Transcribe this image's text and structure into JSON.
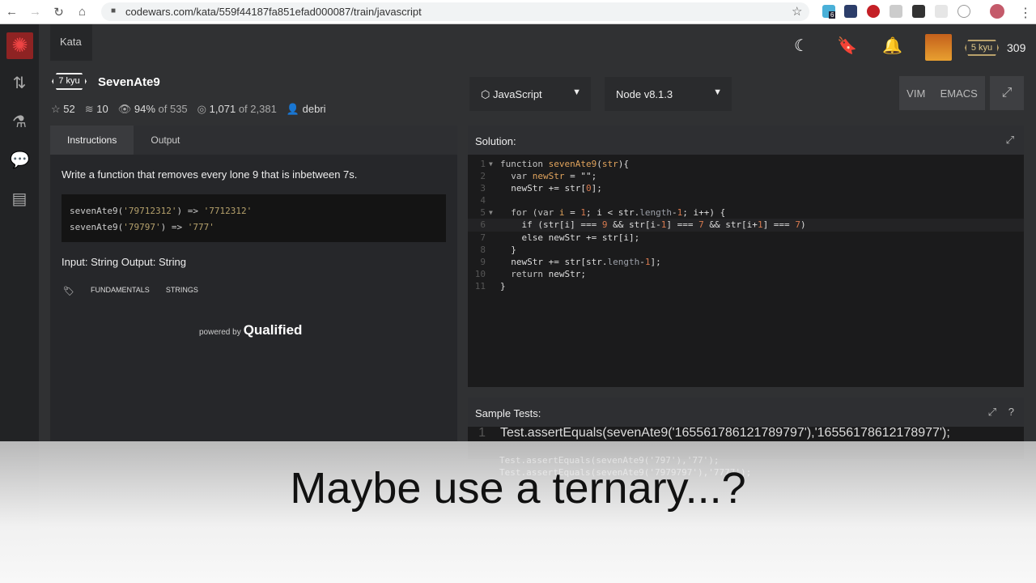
{
  "browser": {
    "url": "codewars.com/kata/559f44187fa851efad000087/train/javascript",
    "ext_badge": "6"
  },
  "topnav": {
    "kata_label": "Kata",
    "honor": "309",
    "user_rank": "5 kyu"
  },
  "kata": {
    "rank": "7 kyu",
    "title": "SevenAte9",
    "stars": "52",
    "collections": "10",
    "satisfaction": "94%",
    "satisfaction_of": "of 535",
    "completed": "1,071",
    "completed_of": "of 2,381",
    "author": "debri"
  },
  "editor_controls": {
    "language": "JavaScript",
    "runtime": "Node v8.1.3",
    "vim": "VIM",
    "emacs": "EMACS"
  },
  "instructions": {
    "tabs": [
      "Instructions",
      "Output"
    ],
    "description": "Write a function that removes every lone 9 that is inbetween 7s.",
    "examples": [
      {
        "call": "sevenAte9(",
        "arg": "'79712312'",
        "arrow": ") => ",
        "result": "'7712312'"
      },
      {
        "call": "sevenAte9(",
        "arg": "'79797'",
        "arrow": ") => ",
        "result": "'777'"
      }
    ],
    "io": "Input: String Output: String",
    "tags": [
      "FUNDAMENTALS",
      "STRINGS"
    ],
    "powered_by": "powered by",
    "brand": "Qualified"
  },
  "solution": {
    "title": "Solution:",
    "lines": [
      [
        [
          "function ",
          "kw"
        ],
        [
          "sevenAte9",
          "fn"
        ],
        [
          "(",
          "p"
        ],
        [
          "str",
          "var"
        ],
        [
          "){",
          "p"
        ]
      ],
      [
        [
          "  var ",
          "kw"
        ],
        [
          "newStr",
          "var"
        ],
        [
          " = \"\";",
          "p"
        ]
      ],
      [
        [
          "  newStr += str[",
          "p"
        ],
        [
          "0",
          "num"
        ],
        [
          "];",
          "p"
        ]
      ],
      [],
      [
        [
          "  for (var ",
          "kw"
        ],
        [
          "i",
          "var"
        ],
        [
          " = ",
          "p"
        ],
        [
          "1",
          "num"
        ],
        [
          "; i < str.",
          "p"
        ],
        [
          "length",
          "prop"
        ],
        [
          "-",
          "p"
        ],
        [
          "1",
          "num"
        ],
        [
          "; i++) {",
          "p"
        ]
      ],
      [
        [
          "    if (str[i] === ",
          "p"
        ],
        [
          "9",
          "num"
        ],
        [
          " && str[i-",
          "p"
        ],
        [
          "1",
          "num"
        ],
        [
          "] === ",
          "p"
        ],
        [
          "7",
          "num"
        ],
        [
          " && str[i+",
          "p"
        ],
        [
          "1",
          "num"
        ],
        [
          "] === ",
          "p"
        ],
        [
          "7",
          "num"
        ],
        [
          ")",
          "p"
        ]
      ],
      [
        [
          "    else newStr += str[i];",
          "p"
        ]
      ],
      [
        [
          "  }",
          "p"
        ]
      ],
      [
        [
          "  newStr += str[str.",
          "p"
        ],
        [
          "length",
          "prop"
        ],
        [
          "-",
          "p"
        ],
        [
          "1",
          "num"
        ],
        [
          "];",
          "p"
        ]
      ],
      [
        [
          "  return ",
          "kw"
        ],
        [
          "newStr;",
          "p"
        ]
      ],
      [
        [
          "}",
          "p"
        ]
      ]
    ]
  },
  "tests": {
    "title": "Sample Tests:",
    "lines": [
      "Test.assertEquals(sevenAte9('165561786121789797'),'16556178612178977');",
      "Test.assertEquals(sevenAte9('797'),'77');",
      "Test.assertEquals(sevenAte9('7979797'),'7777');"
    ]
  },
  "caption": "Maybe use a ternary...?"
}
